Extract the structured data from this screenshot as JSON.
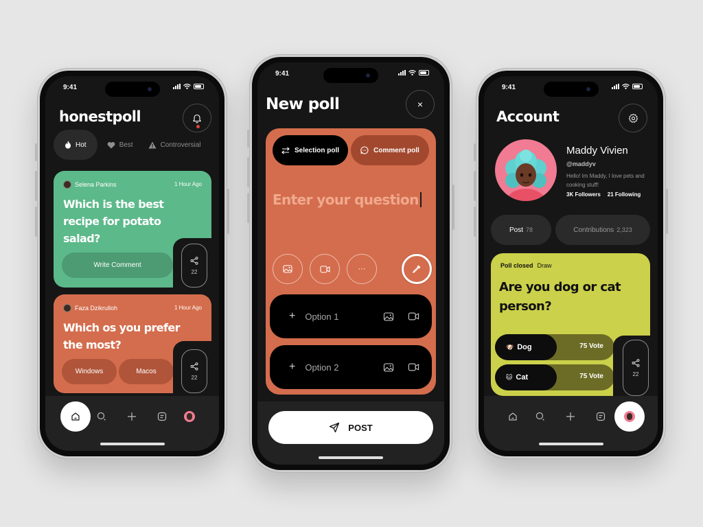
{
  "status": {
    "time": "9:41"
  },
  "phone1": {
    "app_title": "honestpoll",
    "tabs": [
      {
        "label": "Hot",
        "icon": "flame-icon"
      },
      {
        "label": "Best",
        "icon": "heart-icon"
      },
      {
        "label": "Controversial",
        "icon": "warning-icon"
      }
    ],
    "cards": [
      {
        "author": "Selena Parkins",
        "time_ago": "1 Hour Ago",
        "question": "Which is the best recipe for potato salad?",
        "action_label": "Write Comment",
        "share_count": "22",
        "color": "#5cb98a"
      },
      {
        "author": "Faza Dzikrulloh",
        "time_ago": "1 Hour Ago",
        "question": "Which os you prefer the most?",
        "options": [
          "Windows",
          "Macos"
        ],
        "share_count": "22",
        "color": "#d46d4d"
      }
    ]
  },
  "phone2": {
    "title": "New poll",
    "close_symbol": "×",
    "types": [
      "Selection poll",
      "Comment poll"
    ],
    "question_placeholder": "Enter your question",
    "more_symbol": "···",
    "options": [
      "Option 1",
      "Option 2"
    ],
    "post_label": "POST"
  },
  "phone3": {
    "title": "Account",
    "name": "Maddy Vivien",
    "handle": "@maddyv",
    "bio": "Hello! Im Maddy, I love pets and cooking stuff!",
    "followers": "3K Followers",
    "following": "21 Following",
    "stats": [
      {
        "label": "Post",
        "count": "78"
      },
      {
        "label": "Contributions",
        "count": "2,323"
      }
    ],
    "poll": {
      "status": "Poll closed",
      "result": "Draw",
      "question": "Are you dog or cat person?",
      "options": [
        {
          "emoji": "🐶",
          "label": "Dog",
          "votes": "75 Vote"
        },
        {
          "emoji": "🐱",
          "label": "Cat",
          "votes": "75 Vote"
        }
      ],
      "share_count": "22"
    }
  }
}
